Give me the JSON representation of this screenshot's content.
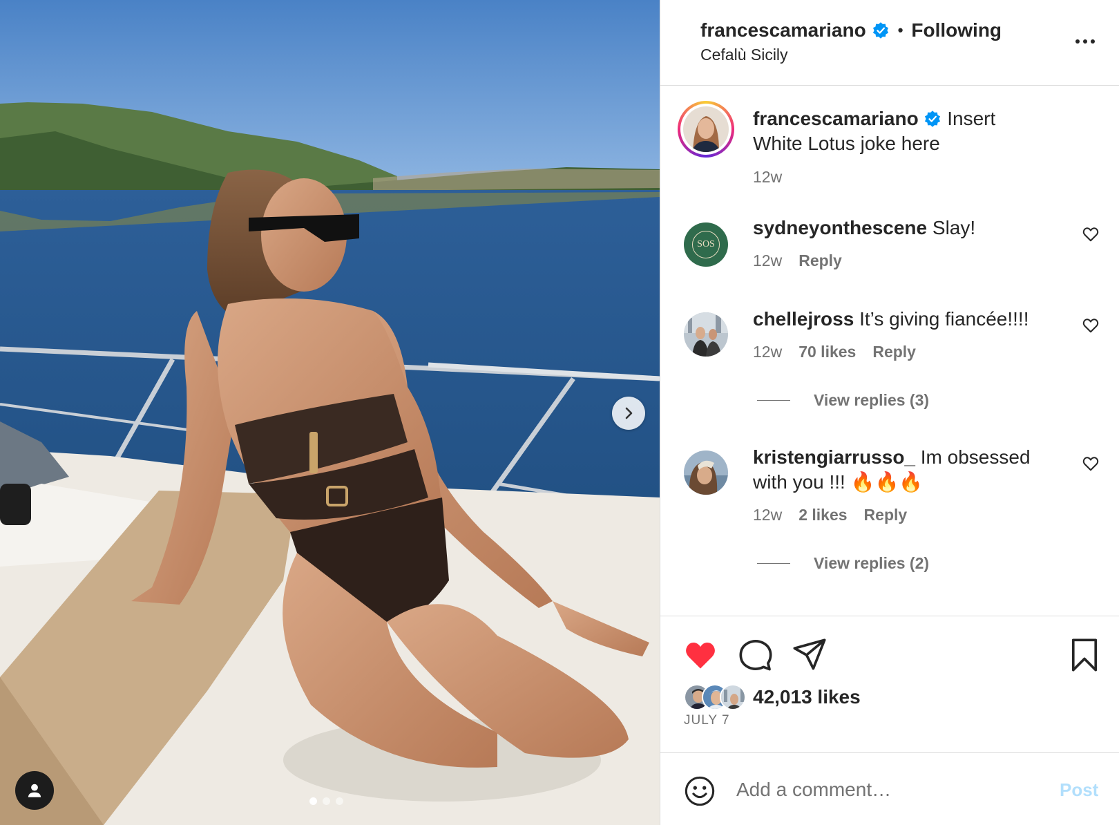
{
  "post": {
    "author": "francescamariano",
    "following_label": "Following",
    "separator": "•",
    "location": "Cefalù Sicily",
    "caption": "Insert White Lotus joke here",
    "caption_time": "12w",
    "likes": "42,013 likes",
    "date": "JULY 7"
  },
  "comments": [
    {
      "user": "sydneyonthescene",
      "text": "Slay!",
      "time": "12w",
      "likes": "",
      "reply": "Reply",
      "avatar_text": "SOS"
    },
    {
      "user": "chellejross",
      "text": "It’s giving fiancée!!!!",
      "time": "12w",
      "likes": "70 likes",
      "reply": "Reply",
      "view_replies": "View replies (3)"
    },
    {
      "user": "kristengiarrusso_",
      "text": "Im obsessed with you !!! 🔥🔥🔥",
      "time": "12w",
      "likes": "2 likes",
      "reply": "Reply",
      "view_replies": "View replies (2)"
    }
  ],
  "composer": {
    "placeholder": "Add a comment…",
    "post_label": "Post"
  },
  "icons": {
    "verified": "verified-badge-icon",
    "more": "more-options-icon",
    "like": "heart-filled-icon",
    "comment": "comment-icon",
    "share": "share-icon",
    "save": "bookmark-icon",
    "emoji": "emoji-icon",
    "next": "chevron-right-icon",
    "tag": "user-tag-icon"
  },
  "colors": {
    "verified": "#0095f6",
    "like_red": "#ff3040",
    "muted_text": "#737373",
    "post_disabled": "#b2dffc",
    "divider": "#dbdbdb"
  },
  "carousel": {
    "count": 3,
    "active": 1
  }
}
